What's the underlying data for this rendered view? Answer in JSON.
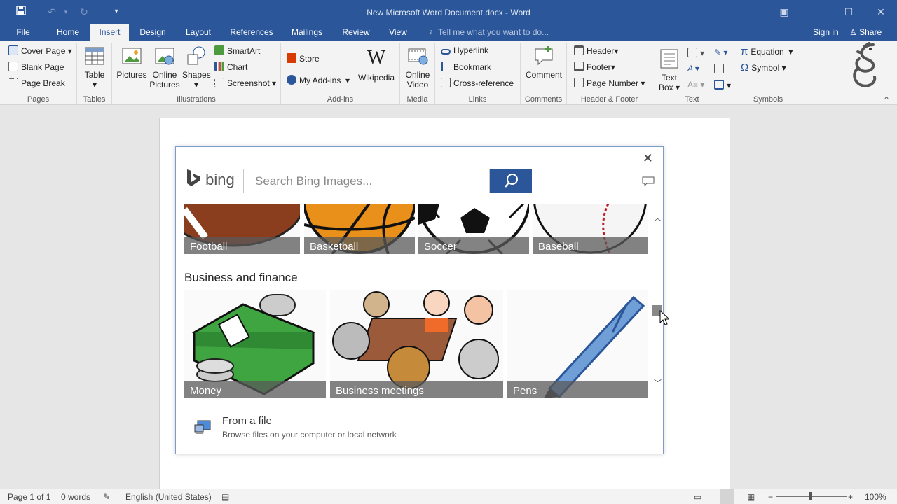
{
  "window": {
    "title": "New Microsoft Word Document.docx - Word"
  },
  "tabs": [
    "File",
    "Home",
    "Insert",
    "Design",
    "Layout",
    "References",
    "Mailings",
    "Review",
    "View"
  ],
  "active_tab": "Insert",
  "tell_me": "Tell me what you want to do...",
  "account": {
    "sign_in": "Sign in",
    "share": "Share"
  },
  "ribbon": {
    "pages": {
      "label": "Pages",
      "items": [
        "Cover Page",
        "Blank Page",
        "Page Break"
      ]
    },
    "tables": {
      "label": "Tables",
      "table": "Table"
    },
    "illustrations": {
      "label": "Illustrations",
      "pictures": "Pictures",
      "online_pictures_1": "Online",
      "online_pictures_2": "Pictures",
      "shapes": "Shapes",
      "smartart": "SmartArt",
      "chart": "Chart",
      "screenshot": "Screenshot"
    },
    "addins": {
      "label": "Add-ins",
      "store": "Store",
      "my_addins": "My Add-ins",
      "wikipedia": "Wikipedia"
    },
    "media": {
      "label": "Media",
      "online_video_1": "Online",
      "online_video_2": "Video"
    },
    "links": {
      "label": "Links",
      "hyperlink": "Hyperlink",
      "bookmark": "Bookmark",
      "cross_reference": "Cross-reference"
    },
    "comments": {
      "label": "Comments",
      "comment": "Comment"
    },
    "header_footer": {
      "label": "Header & Footer",
      "header": "Header",
      "footer": "Footer",
      "page_number": "Page Number"
    },
    "text": {
      "label": "Text",
      "text_box_1": "Text",
      "text_box_2": "Box"
    },
    "symbols": {
      "label": "Symbols",
      "equation": "Equation",
      "symbol": "Symbol"
    }
  },
  "dialog": {
    "brand": "bing",
    "search_placeholder": "Search Bing Images...",
    "sports_tiles": [
      "Football",
      "Basketball",
      "Soccer",
      "Baseball"
    ],
    "section_title": "Business and finance",
    "business_tiles": [
      "Money",
      "Business meetings",
      "Pens"
    ],
    "from_file_title": "From a file",
    "from_file_sub": "Browse files on your computer or local network"
  },
  "status": {
    "page": "Page 1 of 1",
    "words": "0 words",
    "language": "English (United States)",
    "zoom": "100%"
  },
  "colors": {
    "brand_blue": "#2b579a"
  }
}
